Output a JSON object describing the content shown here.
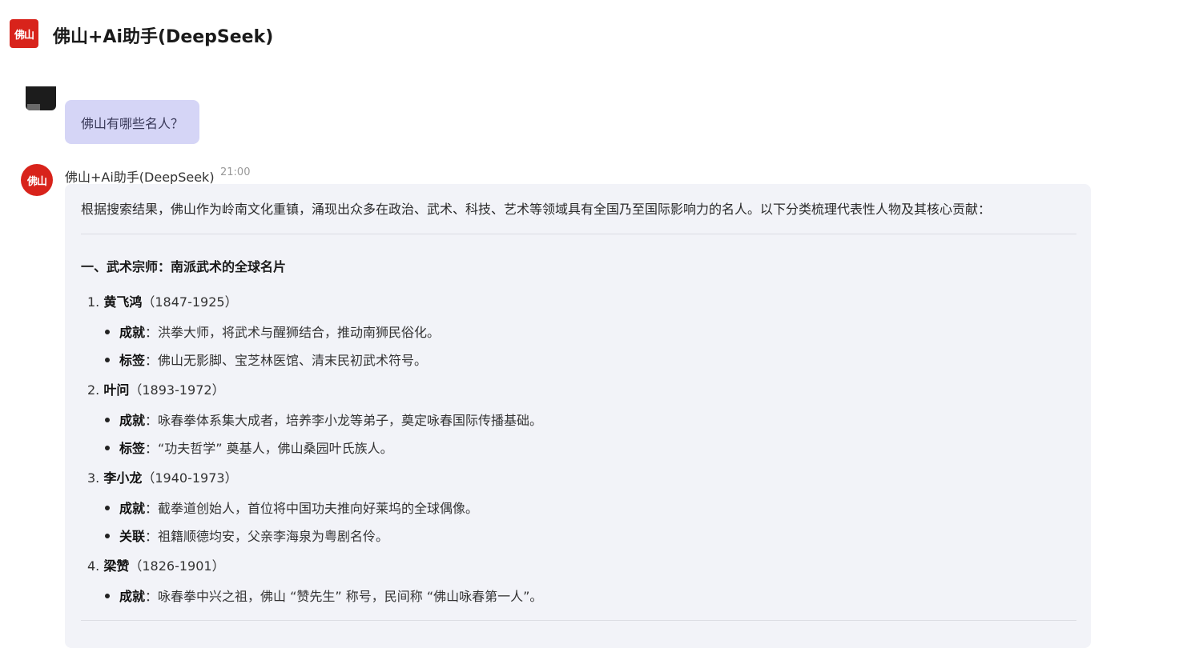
{
  "app": {
    "logo_text": "佛山",
    "title": "佛山+Ai助手(DeepSeek)"
  },
  "user_message": {
    "text": "佛山有哪些名人？"
  },
  "bot_message": {
    "avatar_text": "佛山",
    "name": "佛山+Ai助手(DeepSeek)",
    "time": "21:00",
    "intro": "根据搜索结果，佛山作为岭南文化重镇，涌现出众多在政治、武术、科技、艺术等领域具有全国乃至国际影响力的名人。以下分类梳理代表性人物及其核心贡献：",
    "section_heading": "一、武术宗师：南派武术的全球名片",
    "people": [
      {
        "number": "1.",
        "name": "黄飞鸿",
        "years": "（1847-1925）",
        "bullets": [
          {
            "label": "成就",
            "text": "：洪拳大师，将武术与醒狮结合，推动南狮民俗化。"
          },
          {
            "label": "标签",
            "text": "：佛山无影脚、宝芝林医馆、清末民初武术符号。"
          }
        ]
      },
      {
        "number": "2.",
        "name": "叶问",
        "years": "（1893-1972）",
        "bullets": [
          {
            "label": "成就",
            "text": "：咏春拳体系集大成者，培养李小龙等弟子，奠定咏春国际传播基础。"
          },
          {
            "label": "标签",
            "text": "：“功夫哲学” 奠基人，佛山桑园叶氏族人。"
          }
        ]
      },
      {
        "number": "3.",
        "name": "李小龙",
        "years": "（1940-1973）",
        "bullets": [
          {
            "label": "成就",
            "text": "：截拳道创始人，首位将中国功夫推向好莱坞的全球偶像。"
          },
          {
            "label": "关联",
            "text": "：祖籍顺德均安，父亲李海泉为粤剧名伶。"
          }
        ]
      },
      {
        "number": "4.",
        "name": "梁赞",
        "years": "（1826-1901）",
        "bullets": [
          {
            "label": "成就",
            "text": "：咏春拳中兴之祖，佛山 “赞先生” 称号，民间称 “佛山咏春第一人”。"
          }
        ]
      }
    ]
  }
}
